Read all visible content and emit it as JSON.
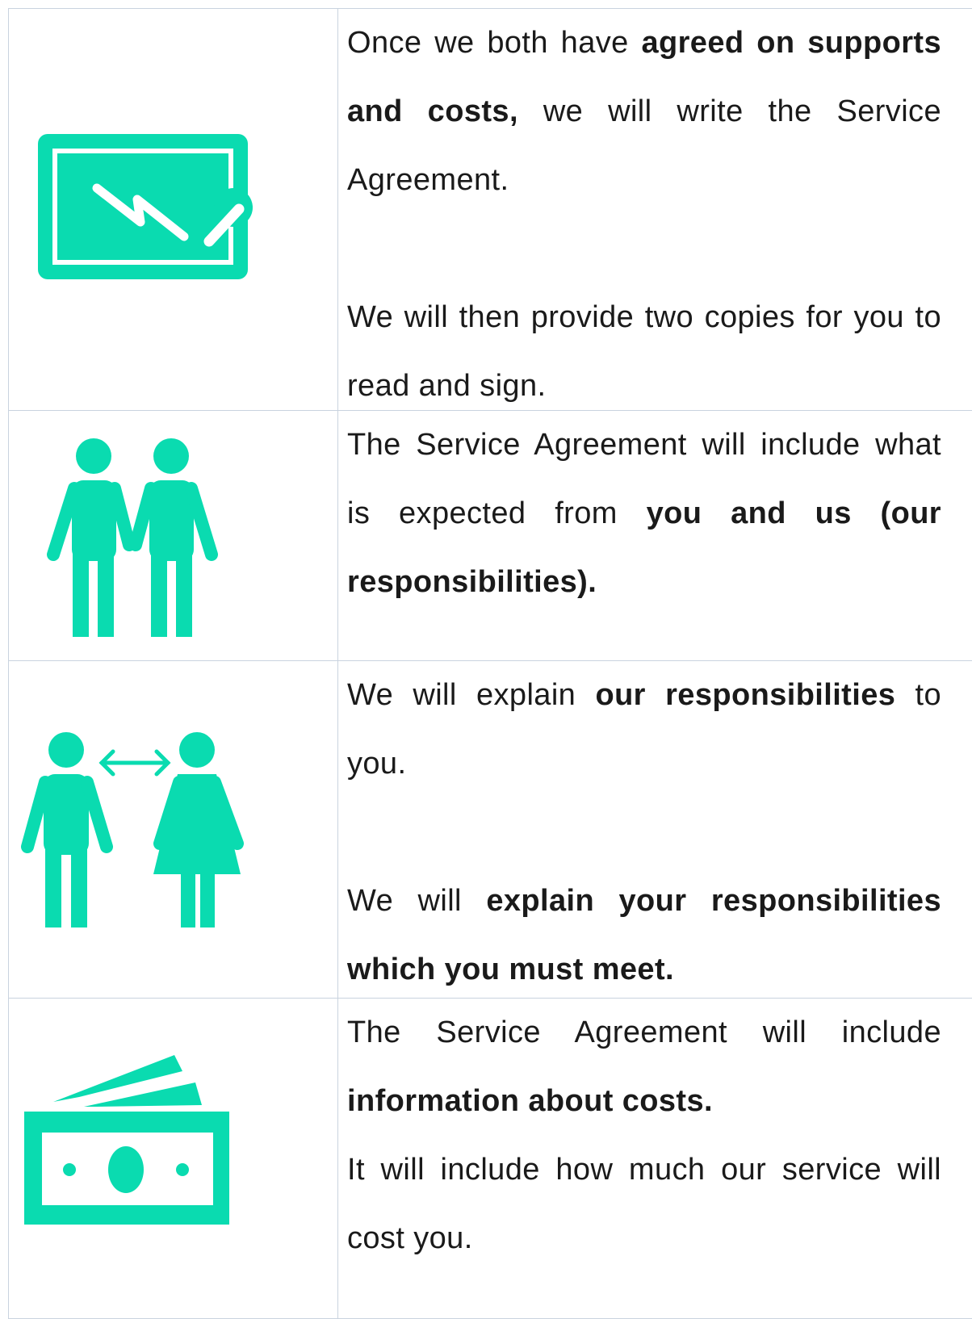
{
  "colors": {
    "accent": "#0adbb0",
    "rule": "#c9d3df",
    "text": "#1a1a1a"
  },
  "rows": [
    {
      "icon": "signature-board-icon",
      "p1": {
        "a": "Once we both have ",
        "b": "agreed on supports and costs,",
        "c": " we will write the Service Agreement."
      },
      "p2": "We will then provide two copies for you to read and sign."
    },
    {
      "icon": "two-people-holding-hands-icon",
      "p1": {
        "a": "The Service Agreement will include what is expected from ",
        "b": "you and us (our responsibilities)."
      }
    },
    {
      "icon": "people-communicating-icon",
      "p1": {
        "a": "We will explain ",
        "b": "our responsibilities",
        "c": " to you."
      },
      "p2": {
        "a": "We will ",
        "b": "explain your responsibilities which you must meet."
      }
    },
    {
      "icon": "money-icon",
      "p1": {
        "a": "The Service Agreement will include ",
        "b": "information about costs."
      },
      "p2": "It will include how much our service will cost you."
    }
  ]
}
